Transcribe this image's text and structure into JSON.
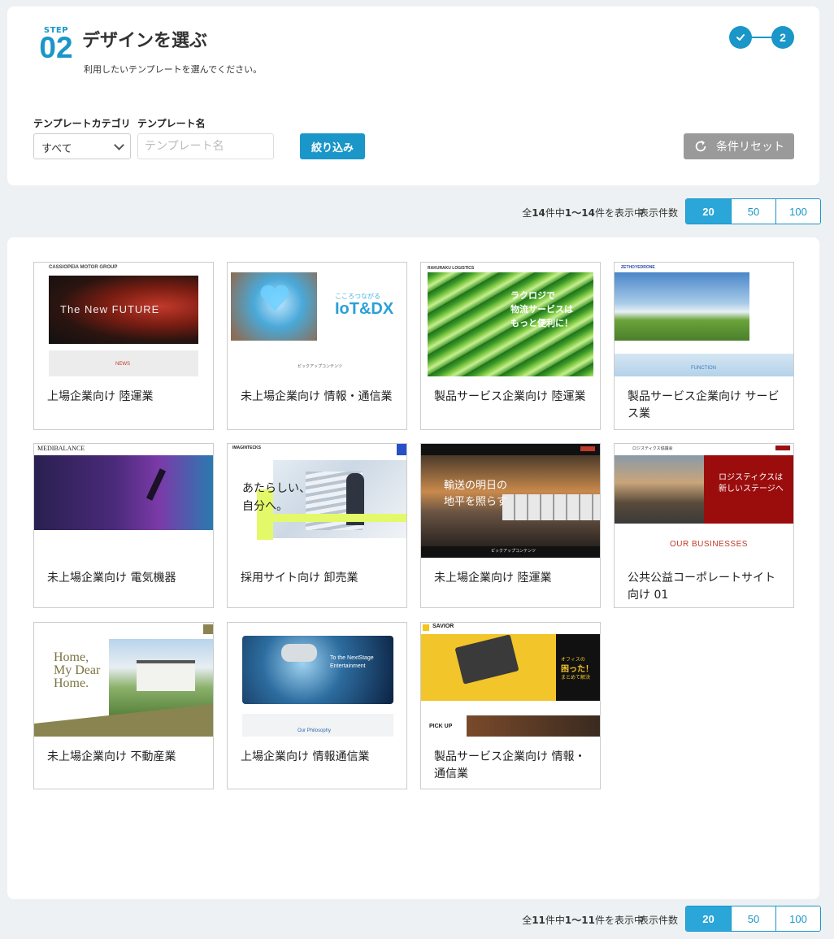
{
  "header": {
    "step_label": "STEP",
    "step_number": "02",
    "title": "デザインを選ぶ",
    "subtitle": "利用したいテンプレートを選んでください。",
    "progress": {
      "step1_icon": "check-icon",
      "step2_label": "2"
    }
  },
  "filters": {
    "category_label": "テンプレートカテゴリ",
    "category_value": "すべて",
    "name_label": "テンプレート名",
    "name_placeholder": "テンプレート名",
    "filter_button": "絞り込み",
    "reset_button": "条件リセット"
  },
  "pager_top": {
    "prefix": "全",
    "total": "14",
    "middle": "件中",
    "range": "1〜14",
    "suffix": "件を表示中",
    "per_page_label": "表示件数",
    "options": [
      "20",
      "50",
      "100"
    ],
    "active": "20"
  },
  "pager_bottom": {
    "prefix": "全",
    "total": "11",
    "middle": "件中",
    "range": "1〜11",
    "suffix": "件を表示中",
    "per_page_label": "表示件数",
    "options": [
      "20",
      "50",
      "100"
    ],
    "active": "20"
  },
  "templates": [
    {
      "name": "上場企業向け 陸運業",
      "thumb_texts": [
        "CASSIOPEIA MOTOR GROUP",
        "The New FUTURE",
        "NEWS"
      ]
    },
    {
      "name": "未上場企業向け 情報・通信業",
      "thumb_texts": [
        "こころつながる",
        "IoT&DX",
        "ピックアップコンテンツ"
      ]
    },
    {
      "name": "製品サービス企業向け 陸運業",
      "thumb_texts": [
        "RAKURAKU LOGISTICS",
        "ラクロジで",
        "物流サービスは",
        "もっと便利に！"
      ]
    },
    {
      "name": "製品サービス企業向け サービス業",
      "thumb_texts": [
        "ZETHOYEDRONE",
        "FUNCTION"
      ]
    },
    {
      "name": "未上場企業向け 電気機器",
      "thumb_texts": [
        "MEDIBALANCE"
      ]
    },
    {
      "name": "採用サイト向け 卸売業",
      "thumb_texts": [
        "IMAGINTECKS",
        "あたらしい、",
        "自分へ。"
      ]
    },
    {
      "name": "未上場企業向け 陸運業",
      "thumb_texts": [
        "輸送の明日の",
        "地平を照らす",
        "ピックアップコンテンツ"
      ]
    },
    {
      "name": "公共公益コーポレートサイト向け 01",
      "thumb_texts": [
        "ロジスティクス協議会",
        "ロジスティクスは",
        "新しいステージへ",
        "OUR BUSINESSES"
      ]
    },
    {
      "name": "未上場企業向け 不動産業",
      "thumb_texts": [
        "Home,",
        "My Dear",
        "Home."
      ]
    },
    {
      "name": "上場企業向け 情報通信業",
      "thumb_texts": [
        "To the NextStage",
        "Entertainment",
        "Our Philosophy"
      ]
    },
    {
      "name": "製品サービス企業向け 情報・通信業",
      "thumb_texts": [
        "SAVIOR",
        "オフィスの",
        "困った！",
        "まとめて解決",
        "PICK UP"
      ]
    }
  ]
}
